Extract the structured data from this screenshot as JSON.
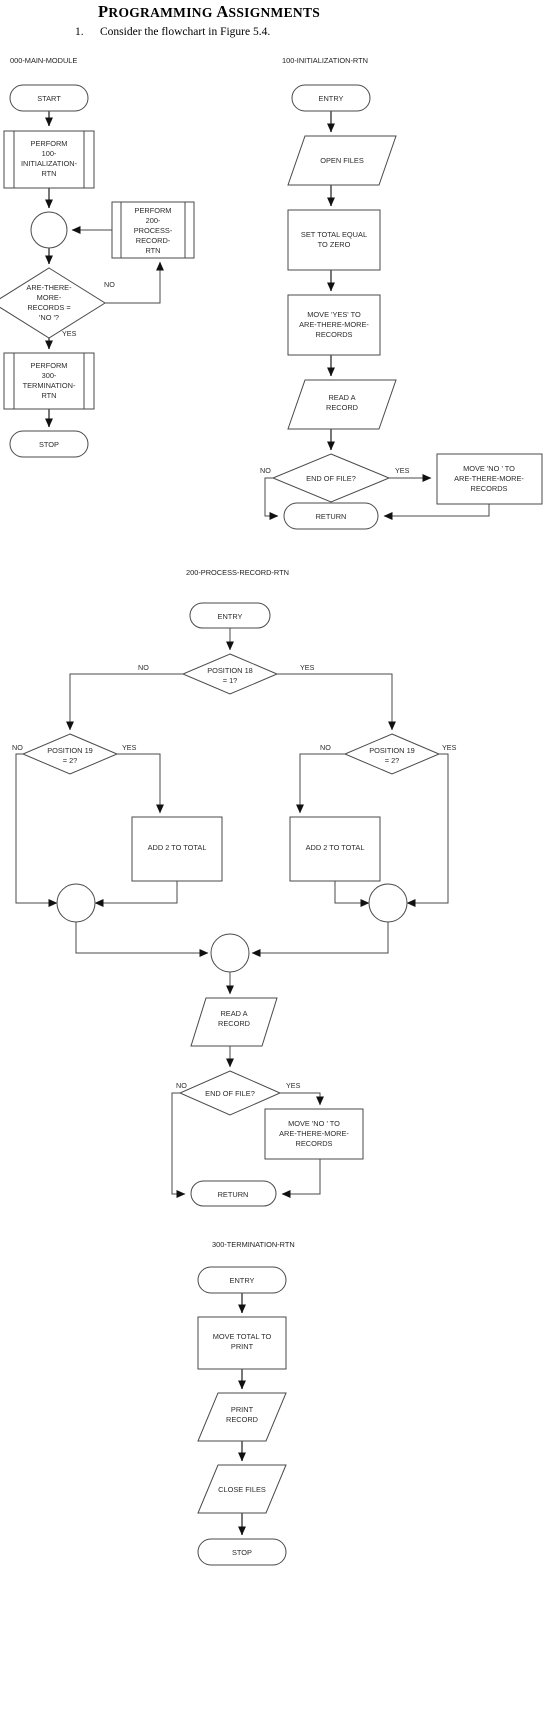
{
  "header": {
    "title": "Programming Assignments",
    "title_first_letters": "PA",
    "question_number": "1.",
    "question_text": "Consider the flowchart in Figure 5.4."
  },
  "flowcharts": [
    {
      "id": "main-module",
      "name": "000-MAIN-MODULE",
      "nodes": [
        {
          "key": "start",
          "type": "terminal",
          "label": "START"
        },
        {
          "key": "perform100",
          "type": "predefined",
          "label": "PERFORM 100- INITIALIZATION- RTN",
          "lines": [
            "PERFORM",
            "100-",
            "INITIALIZATION-",
            "RTN"
          ]
        },
        {
          "key": "merge1",
          "type": "connector",
          "label": ""
        },
        {
          "key": "decide1",
          "type": "decision",
          "label": "ARE-THERE- MORE- RECORDS = 'NO '?",
          "lines": [
            "ARE-THERE-",
            "MORE-",
            "RECORDS =",
            "'NO '?"
          ]
        },
        {
          "key": "perform200",
          "type": "predefined",
          "label": "PERFORM 200- PROCESS- RECORD- RTN",
          "lines": [
            "PERFORM",
            "200-",
            "PROCESS-",
            "RECORD-",
            "RTN"
          ]
        },
        {
          "key": "perform300",
          "type": "predefined",
          "label": "PERFORM 300- TERMINATION- RTN",
          "lines": [
            "PERFORM",
            "300-",
            "TERMINATION-",
            "RTN"
          ]
        },
        {
          "key": "stop",
          "type": "terminal",
          "label": "STOP"
        }
      ],
      "edge_labels": {
        "no": "NO",
        "yes": "YES"
      }
    },
    {
      "id": "initialization-rtn",
      "name": "100-INITIALIZATION-RTN",
      "nodes": [
        {
          "key": "entry",
          "type": "terminal",
          "label": "ENTRY"
        },
        {
          "key": "openfiles",
          "type": "io",
          "label": "OPEN FILES",
          "lines": [
            "OPEN FILES"
          ]
        },
        {
          "key": "settotal",
          "type": "process",
          "label": "SET TOTAL EQUAL TO ZERO",
          "lines": [
            "SET TOTAL EQUAL",
            "TO ZERO"
          ]
        },
        {
          "key": "moveyes",
          "type": "process",
          "label": "MOVE 'YES' TO ARE-THERE-MORE-RECORDS",
          "lines": [
            "MOVE 'YES' TO",
            "ARE-THERE-MORE-",
            "RECORDS"
          ]
        },
        {
          "key": "readrec",
          "type": "io",
          "label": "READ A RECORD",
          "lines": [
            "READ A",
            "RECORD"
          ]
        },
        {
          "key": "eof",
          "type": "decision",
          "label": "END OF FILE?",
          "lines": [
            "END OF FILE?"
          ]
        },
        {
          "key": "moveno",
          "type": "process",
          "label": "MOVE 'NO ' TO ARE-THERE-MORE-RECORDS",
          "lines": [
            "MOVE 'NO ' TO",
            "ARE-THERE-MORE-",
            "RECORDS"
          ]
        },
        {
          "key": "return",
          "type": "terminal",
          "label": "RETURN"
        }
      ],
      "edge_labels": {
        "no": "NO",
        "yes": "YES"
      }
    },
    {
      "id": "process-record-rtn",
      "name": "200-PROCESS-RECORD-RTN",
      "nodes": [
        {
          "key": "entry",
          "type": "terminal",
          "label": "ENTRY"
        },
        {
          "key": "pos18",
          "type": "decision",
          "label": "POSITION 18 = 1?",
          "lines": [
            "POSITION 18",
            "= 1?"
          ]
        },
        {
          "key": "pos19left",
          "type": "decision",
          "label": "POSITION 19 = 2?",
          "lines": [
            "POSITION 19",
            "= 2?"
          ]
        },
        {
          "key": "pos19right",
          "type": "decision",
          "label": "POSITION 19 = 2?",
          "lines": [
            "POSITION 19",
            "= 2?"
          ]
        },
        {
          "key": "addleft",
          "type": "process",
          "label": "ADD 2 TO TOTAL",
          "lines": [
            "ADD 2 TO TOTAL"
          ]
        },
        {
          "key": "addright",
          "type": "process",
          "label": "ADD 2 TO TOTAL",
          "lines": [
            "ADD 2 TO TOTAL"
          ]
        },
        {
          "key": "mergeleft",
          "type": "connector",
          "label": ""
        },
        {
          "key": "mergeright",
          "type": "connector",
          "label": ""
        },
        {
          "key": "mergemain",
          "type": "connector",
          "label": ""
        },
        {
          "key": "readrec",
          "type": "io",
          "label": "READ A RECORD",
          "lines": [
            "READ A",
            "RECORD"
          ]
        },
        {
          "key": "eof",
          "type": "decision",
          "label": "END OF FILE?",
          "lines": [
            "END OF FILE?"
          ]
        },
        {
          "key": "moveno",
          "type": "process",
          "label": "MOVE 'NO ' TO ARE-THERE-MORE-RECORDS",
          "lines": [
            "MOVE 'NO ' TO",
            "ARE-THERE-MORE-",
            "RECORDS"
          ]
        },
        {
          "key": "return",
          "type": "terminal",
          "label": "RETURN"
        }
      ],
      "edge_labels": {
        "no": "NO",
        "yes": "YES"
      }
    },
    {
      "id": "termination-rtn",
      "name": "300-TERMINATION-RTN",
      "nodes": [
        {
          "key": "entry",
          "type": "terminal",
          "label": "ENTRY"
        },
        {
          "key": "movetotal",
          "type": "process",
          "label": "MOVE TOTAL TO PRINT",
          "lines": [
            "MOVE TOTAL TO",
            "PRINT"
          ]
        },
        {
          "key": "printrec",
          "type": "io",
          "label": "PRINT RECORD",
          "lines": [
            "PRINT",
            "RECORD"
          ]
        },
        {
          "key": "closefiles",
          "type": "io",
          "label": "CLOSE FILES",
          "lines": [
            "CLOSE FILES"
          ]
        },
        {
          "key": "stop",
          "type": "terminal",
          "label": "STOP"
        }
      ],
      "edge_labels": {}
    }
  ],
  "labels": {
    "chart1_name": "000-MAIN-MODULE",
    "chart2_name": "100-INITIALIZATION-RTN",
    "chart3_name": "200-PROCESS-RECORD-RTN",
    "chart4_name": "300-TERMINATION-RTN",
    "start": "START",
    "stop": "STOP",
    "entry": "ENTRY",
    "return": "RETURN",
    "yes": "YES",
    "no": "NO",
    "open_files": "OPEN FILES",
    "close_files": "CLOSE FILES",
    "end_of_file": "END OF FILE?",
    "add_2_to_total": "ADD 2 TO TOTAL",
    "perform_1": "PERFORM",
    "perform_100_1": "100-",
    "perform_100_2": "INITIALIZATION-",
    "perform_100_3": "RTN",
    "perform_200_1": "200-",
    "perform_200_2": "PROCESS-",
    "perform_200_3": "RECORD-",
    "perform_200_4": "RTN",
    "perform_300_1": "300-",
    "perform_300_2": "TERMINATION-",
    "perform_300_3": "RTN",
    "decide_1": "ARE-THERE-",
    "decide_2": "MORE-",
    "decide_3": "RECORDS =",
    "decide_4": "'NO '?",
    "settotal_1": "SET TOTAL EQUAL",
    "settotal_2": "TO ZERO",
    "moveyes_1": "MOVE 'YES' TO",
    "moveyes_2": "ARE-THERE-MORE-",
    "moveyes_3": "RECORDS",
    "moveno_1": "MOVE 'NO ' TO",
    "moveno_2": "ARE-THERE-MORE-",
    "moveno_3": "RECORDS",
    "read_1": "READ A",
    "read_2": "RECORD",
    "pos18_1": "POSITION 18",
    "pos18_2": "= 1?",
    "pos19_1": "POSITION 19",
    "pos19_2": "= 2?",
    "movetotal_1": "MOVE TOTAL TO",
    "movetotal_2": "PRINT",
    "print_1": "PRINT",
    "print_2": "RECORD"
  },
  "colors": {
    "page_background": "#ffffff",
    "shape_stroke": "#4a4a4a",
    "connector_stroke": "#555555",
    "text": "#2b2b2b",
    "arrow": "#111111"
  }
}
